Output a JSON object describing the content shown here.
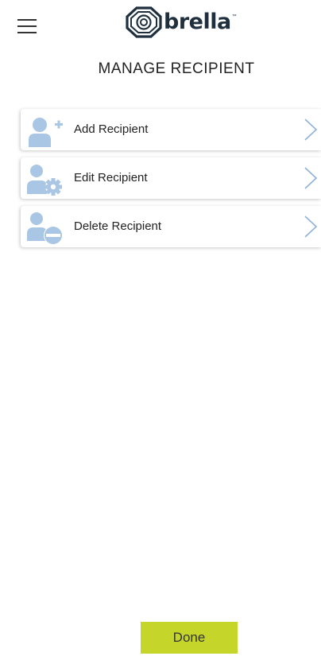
{
  "header": {
    "brand_name": "brella",
    "brand_tm": "™",
    "menu_icon": "hamburger-icon"
  },
  "page": {
    "title": "MANAGE RECIPIENT"
  },
  "menu_items": [
    {
      "label": "Add Recipient",
      "icon": "user-add-icon"
    },
    {
      "label": "Edit Recipient",
      "icon": "user-settings-icon"
    },
    {
      "label": "Delete Recipient",
      "icon": "user-remove-icon"
    }
  ],
  "footer": {
    "done_label": "Done"
  },
  "colors": {
    "accent": "#c5d52a",
    "icon_blue": "#a9c6e4",
    "brand_dark": "#1f2f3d",
    "chevron": "#8fb1d8"
  }
}
